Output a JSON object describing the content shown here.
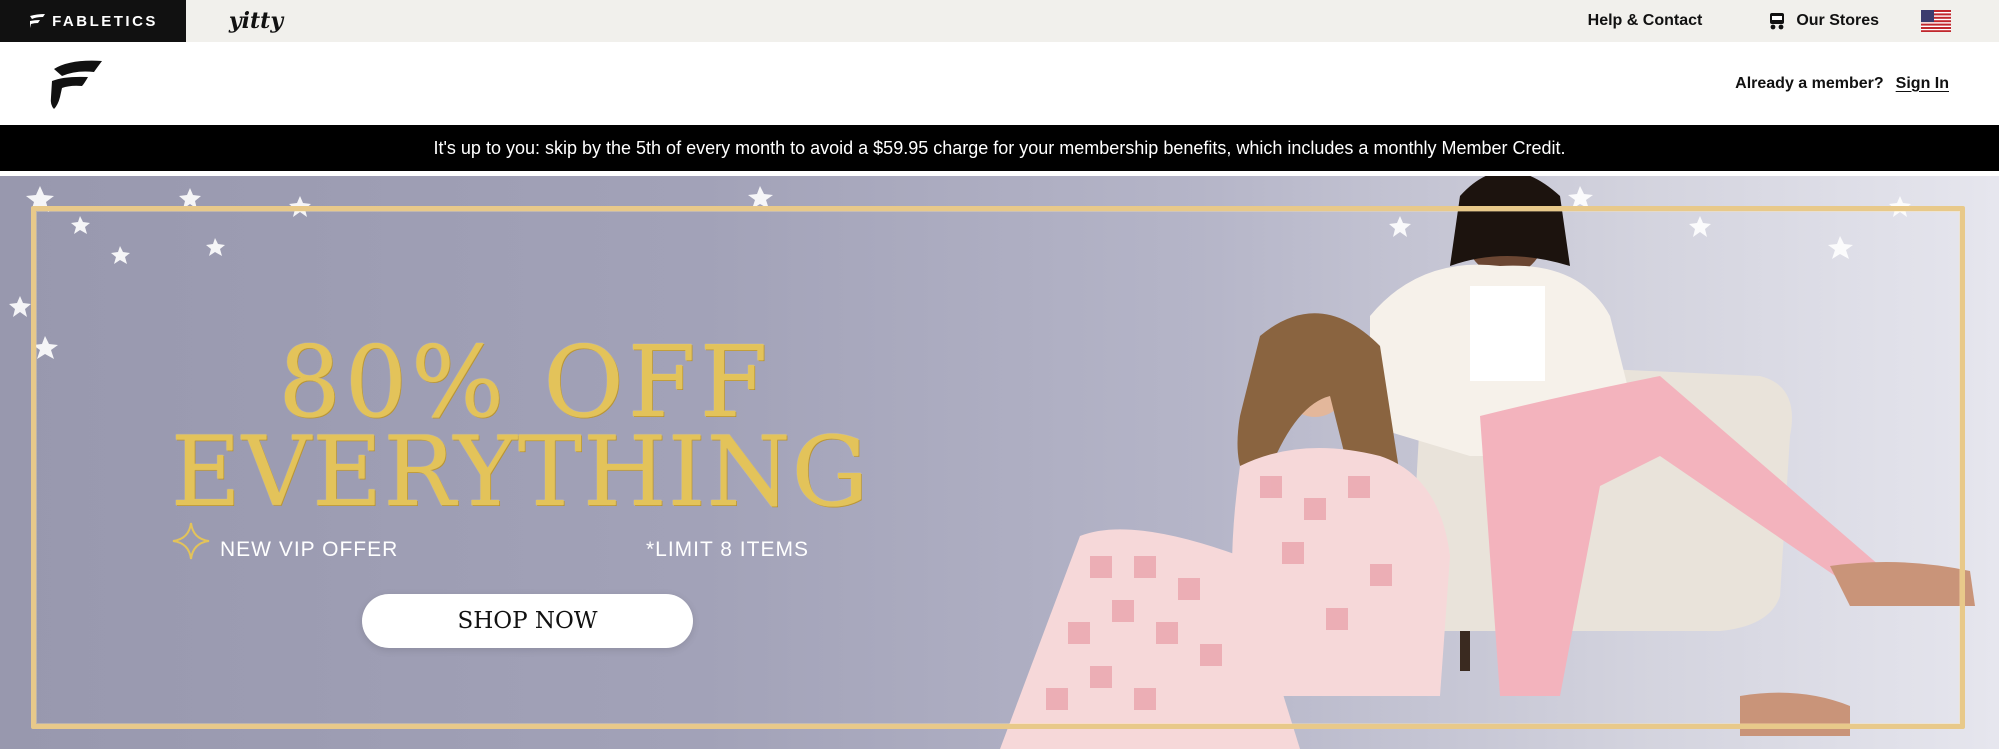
{
  "brand_tabs": {
    "fabletics": "FABLETICS",
    "yitty": "yitty"
  },
  "utility": {
    "help_label": "Help & Contact",
    "stores_label": "Our Stores",
    "flag_icon": "us-flag-icon"
  },
  "header": {
    "member_prompt": "Already a member?",
    "signin_label": "Sign In"
  },
  "promo_strip": {
    "text": "It's up to you: skip by the 5th of every month to avoid a $59.95 charge for your membership benefits, which includes a monthly Member Credit."
  },
  "hero": {
    "headline_line1": "80% OFF",
    "headline_line2": "EVERYTHING",
    "sub_left": "NEW VIP OFFER",
    "sub_right": "*LIMIT 8 ITEMS",
    "cta_label": "SHOP NOW",
    "accent_gold": "#e3c35a",
    "frame_color": "#e8c98a"
  }
}
